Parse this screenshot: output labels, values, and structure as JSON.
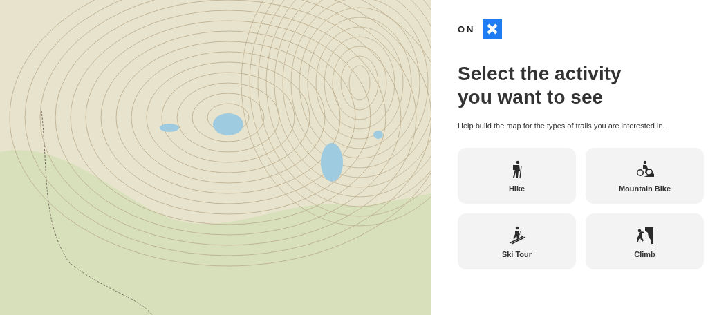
{
  "logo": {
    "text": "ON"
  },
  "heading": {
    "line_1": "Select the activity",
    "line_2": "you want to see"
  },
  "subtitle": "Help build the map for the types of trails you are interested in.",
  "activities": [
    {
      "kind": "hike",
      "label": "Hike"
    },
    {
      "kind": "bike",
      "label": "Mountain Bike"
    },
    {
      "kind": "ski",
      "label": "Ski Tour"
    },
    {
      "kind": "climb",
      "label": "Climb"
    }
  ]
}
